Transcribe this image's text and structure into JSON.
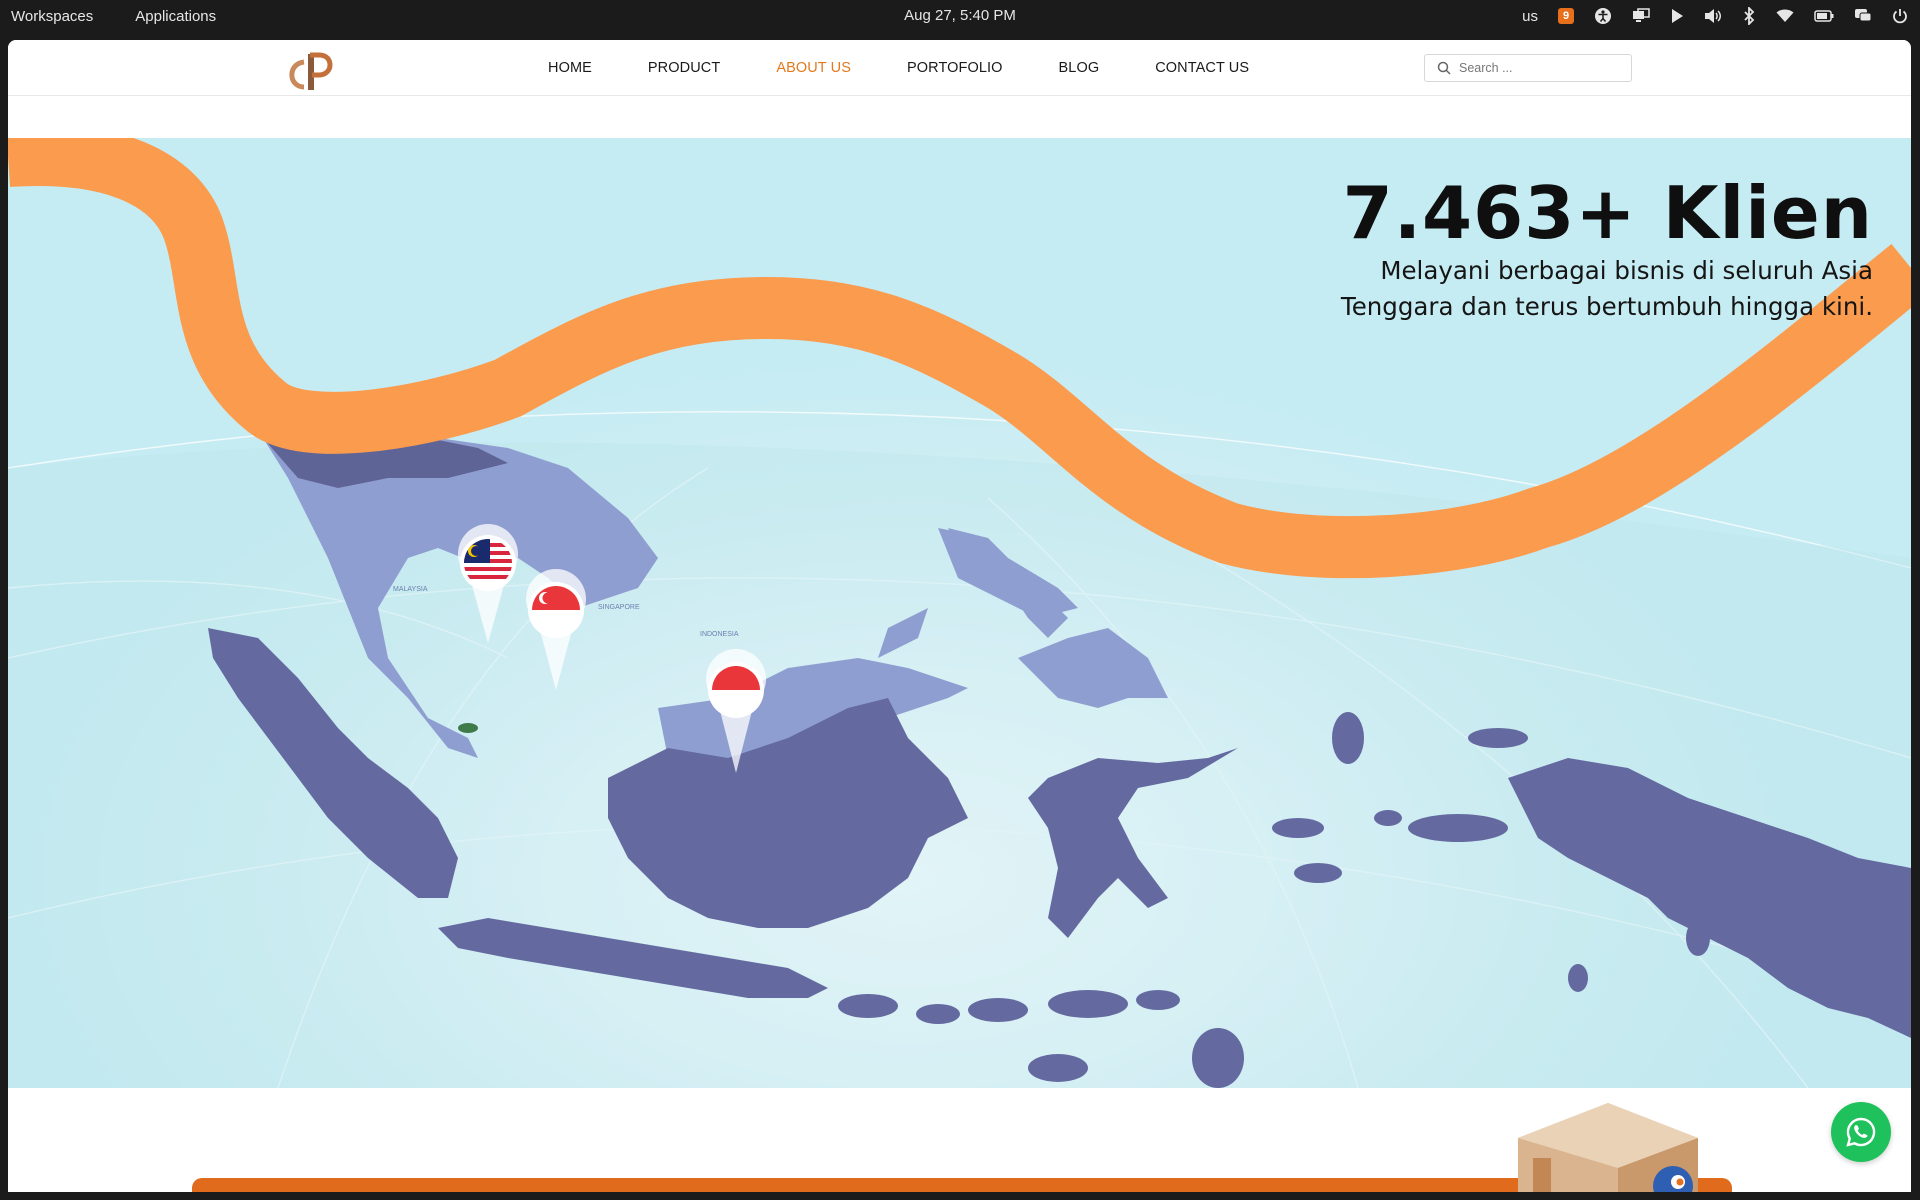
{
  "os_bar": {
    "workspaces_label": "Workspaces",
    "applications_label": "Applications",
    "clock": "Aug 27, 5:40 PM",
    "keyboard_layout": "us",
    "notification_count": "9"
  },
  "site": {
    "nav": {
      "items": [
        {
          "label": "HOME",
          "active": false
        },
        {
          "label": "PRODUCT",
          "active": false
        },
        {
          "label": "ABOUT US",
          "active": true
        },
        {
          "label": "PORTOFOLIO",
          "active": false
        },
        {
          "label": "BLOG",
          "active": false
        },
        {
          "label": "CONTACT US",
          "active": false
        }
      ],
      "active_color": "#e27a1e"
    },
    "search": {
      "placeholder": "Search ..."
    },
    "hero": {
      "title": "7.463+ Klien",
      "subtitle_line1": "Melayani berbagai bisnis di seluruh Asia",
      "subtitle_line2": "Tenggara dan terus bertumbuh hingga kini.",
      "map_labels": {
        "malaysia": "MALAYSIA",
        "singapore": "SINGAPORE",
        "indonesia": "INDONESIA"
      },
      "colors": {
        "land": "#646aa0",
        "land_light": "#8f9ed0",
        "ribbon": "#fa9b4e",
        "sea": "#c6ecf3"
      }
    },
    "whatsapp_icon": "whatsapp-icon"
  }
}
